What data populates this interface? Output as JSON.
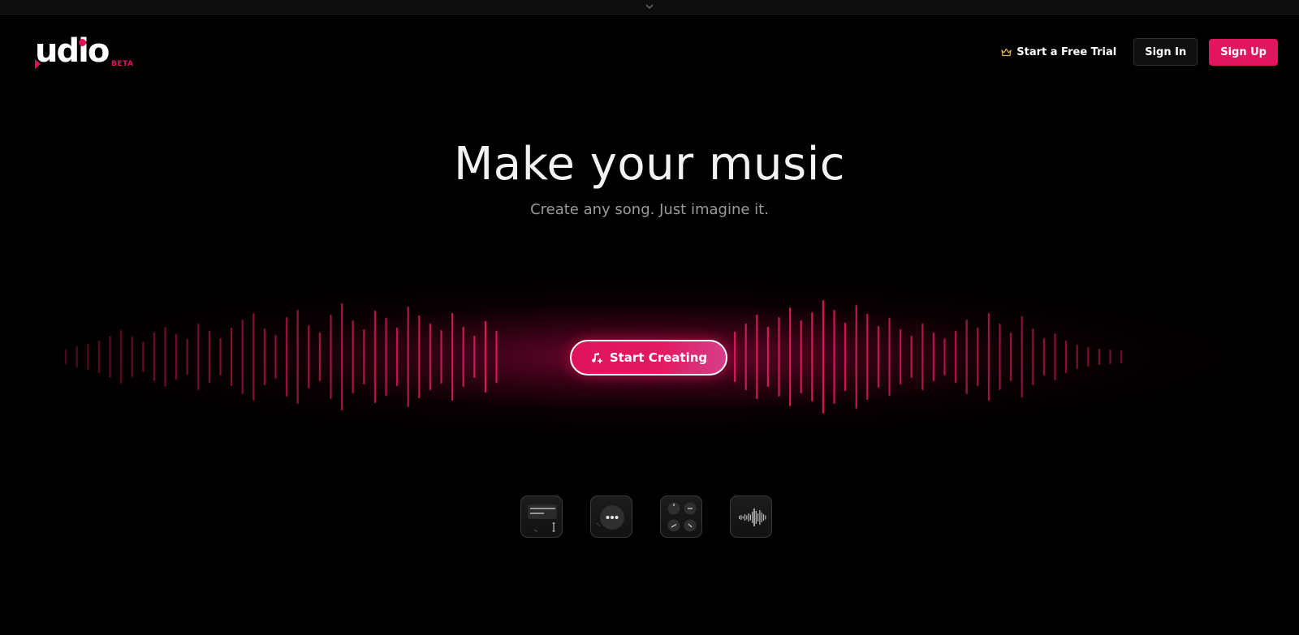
{
  "brand": {
    "name": "udio",
    "tag": "BETA",
    "accent": "#e0165e"
  },
  "nav": {
    "trial_label": "Start a Free Trial",
    "signin_label": "Sign In",
    "signup_label": "Sign Up"
  },
  "hero": {
    "title": "Make your music",
    "subtitle": "Create any song. Just imagine it.",
    "cta_label": "Start Creating"
  },
  "feature_tiles": [
    {
      "icon": "text-prompt-icon"
    },
    {
      "icon": "chat-bubble-icon"
    },
    {
      "icon": "knobs-icon"
    },
    {
      "icon": "waveform-icon"
    }
  ],
  "icons": {
    "top": "chevron-down-icon",
    "trial": "crown-icon",
    "cta": "music-note-plus-icon"
  }
}
